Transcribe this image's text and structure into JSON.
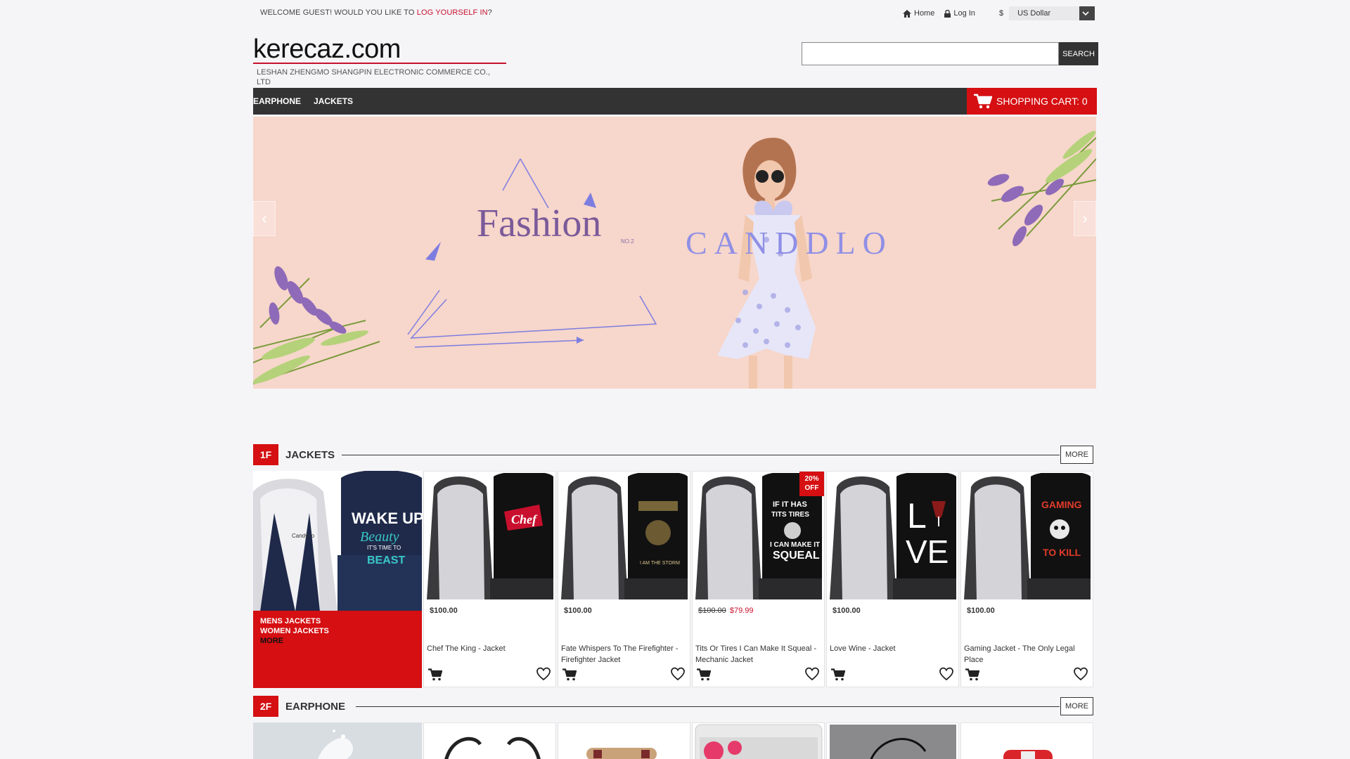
{
  "topbar": {
    "welcome_text": "Welcome guest! Would you like to",
    "login_link": "log yourself in",
    "suffix": "?",
    "home_label": "Home",
    "login_label": "Log In",
    "currency_symbol": "$",
    "currency_value": "US Dollar"
  },
  "header": {
    "logo_text": "kerecaz.com",
    "company_name": "LESHAN ZHENGMO SHANGPIN ELECTRONIC COMMERCE CO., LTD",
    "search_placeholder": "",
    "search_button": "Search"
  },
  "nav": {
    "items": [
      "Earphone",
      "Jackets"
    ],
    "cart_label": "Shopping Cart:",
    "cart_count": "0"
  },
  "banner": {
    "text_fashion": "Fashion",
    "text_no": "NO.2",
    "text_brand": "CANDDLO",
    "colors": {
      "bg": "#f7d6cb",
      "accent": "#7d7de0"
    }
  },
  "floors": [
    {
      "badge": "1F",
      "title": "Jackets",
      "more": "More",
      "promo_menu": [
        "Mens Jackets",
        "Women Jackets"
      ],
      "promo_more": "More",
      "promo_text_1": "WAKE UP",
      "promo_text_2": "Beauty",
      "promo_text_3": "IT'S TIME TO",
      "promo_text_4": "BEAST",
      "products": [
        {
          "price": "$100.00",
          "name": "Chef The King - Jacket",
          "print": "Chef"
        },
        {
          "price": "$100.00",
          "name": "Fate Whispers To The Firefighter - Firefighter Jacket",
          "print": "I AM THE STORM"
        },
        {
          "old_price": "$100.00",
          "new_price": "$79.99",
          "badge": "20% OFF",
          "name": "Tits Or Tires I Can Make It Squeal - Mechanic Jacket",
          "print_1": "IF IT HAS",
          "print_2": "TITS TIRES",
          "print_3": "I CAN MAKE IT",
          "print_4": "SQUEAL"
        },
        {
          "price": "$100.00",
          "name": "Love Wine - Jacket",
          "print_1": "L",
          "print_2": "VE"
        },
        {
          "price": "$100.00",
          "name": "Gaming Jacket - The Only Legal Place",
          "print_1": "GAMING",
          "print_2": "TO KILL"
        }
      ]
    },
    {
      "badge": "2F",
      "title": "Earphone",
      "more": "More"
    }
  ]
}
